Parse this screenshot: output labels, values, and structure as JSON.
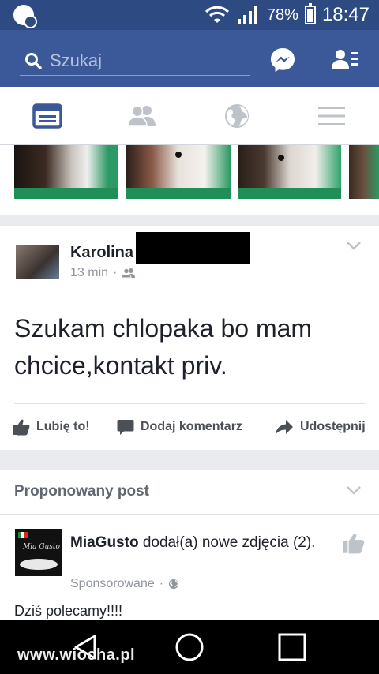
{
  "status_bar": {
    "battery": "78%",
    "time": "18:47"
  },
  "header": {
    "search_placeholder": "Szukaj",
    "icons": [
      "search-icon",
      "messenger-icon",
      "friend-requests-icon"
    ]
  },
  "tabs": [
    {
      "name": "news-feed",
      "icon": "news-feed-icon",
      "active": true
    },
    {
      "name": "friends",
      "icon": "friends-icon",
      "active": false
    },
    {
      "name": "notifications",
      "icon": "globe-icon",
      "active": false
    },
    {
      "name": "menu",
      "icon": "menu-icon",
      "active": false
    }
  ],
  "post": {
    "author": "Karolina",
    "time": "13 min",
    "audience_icon": "friends-icon",
    "text": "Szukam chlopaka bo mam chcice,kontakt priv.",
    "actions": {
      "like": "Lubię to!",
      "comment": "Dodaj komentarz",
      "share": "Udostępnij"
    }
  },
  "suggested": {
    "heading": "Proponowany post",
    "page_name": "MiaGusto",
    "action_text": "dodał(a) nowe zdjęcia (2).",
    "sponsored": "Sponsorowane",
    "body": "Dziś polecamy!!!!"
  },
  "watermark": "www.wiocha.pl",
  "colors": {
    "status_bar": "#2e4a83",
    "header": "#3b5998",
    "accent": "#3b5998",
    "feed_bg": "#e9ebee"
  }
}
